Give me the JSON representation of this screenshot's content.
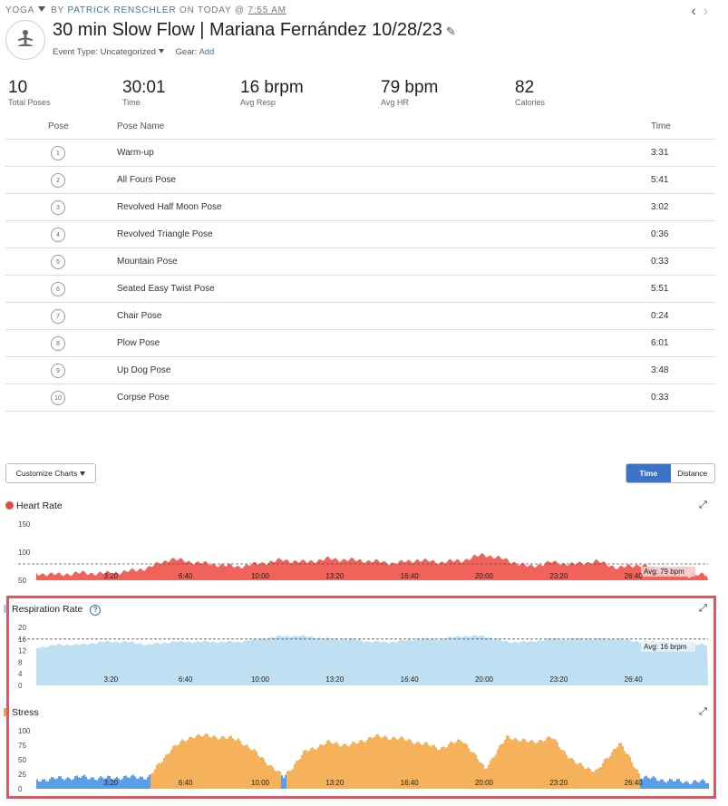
{
  "breadcrumb": {
    "activity_type": "YOGA",
    "by": "BY",
    "author": "PATRICK RENSCHLER",
    "on": "ON TODAY @",
    "time": "7:55 AM"
  },
  "pager": {
    "prev": "‹",
    "next": "›"
  },
  "activity": {
    "title": "30 min Slow Flow | Mariana Fernández 10/28/23",
    "event_type_label": "Event Type:",
    "event_type_value": "Uncategorized",
    "gear_label": "Gear:",
    "gear_link": "Add"
  },
  "stats": [
    {
      "value": "10",
      "label": "Total Poses"
    },
    {
      "value": "30:01",
      "label": "Time"
    },
    {
      "value": "16 brpm",
      "label": "Avg Resp"
    },
    {
      "value": "79 bpm",
      "label": "Avg HR"
    },
    {
      "value": "82",
      "label": "Calories"
    }
  ],
  "pose_table": {
    "headers": {
      "pose": "Pose",
      "name": "Pose Name",
      "time": "Time"
    },
    "rows": [
      {
        "num": "1",
        "name": "Warm-up",
        "time": "3:31"
      },
      {
        "num": "2",
        "name": "All Fours Pose",
        "time": "5:41"
      },
      {
        "num": "3",
        "name": "Revolved Half Moon Pose",
        "time": "3:02"
      },
      {
        "num": "4",
        "name": "Revolved Triangle Pose",
        "time": "0:36"
      },
      {
        "num": "5",
        "name": "Mountain Pose",
        "time": "0:33"
      },
      {
        "num": "6",
        "name": "Seated Easy Twist Pose",
        "time": "5:51"
      },
      {
        "num": "7",
        "name": "Chair Pose",
        "time": "0:24"
      },
      {
        "num": "8",
        "name": "Plow Pose",
        "time": "6:01"
      },
      {
        "num": "9",
        "name": "Up Dog Pose",
        "time": "3:48"
      },
      {
        "num": "10",
        "name": "Corpse Pose",
        "time": "0:33"
      }
    ]
  },
  "chart_controls": {
    "customize": "Customize Charts",
    "time_toggle": "Time",
    "distance_toggle": "Distance"
  },
  "colors": {
    "heart_rate": "#f0625a",
    "respiration": "#bfe0f3",
    "respiration_dot": "#a9c9e6",
    "stress_high": "#f5b25a",
    "stress_low": "#5b9ee8",
    "highlight_box": "#e25563",
    "toggle_active": "#3a73c8"
  },
  "x_ticks": [
    "3:20",
    "6:40",
    "10:00",
    "13:20",
    "16:40",
    "20:00",
    "23:20",
    "26:40"
  ],
  "chart_data": [
    {
      "type": "area",
      "title": "Heart Rate",
      "x": [
        0,
        60,
        120,
        180,
        240,
        300,
        360,
        420,
        480,
        540,
        600,
        660,
        720,
        780,
        840,
        900,
        960,
        1020,
        1080,
        1140,
        1200,
        1260,
        1320,
        1380,
        1440,
        1500,
        1560,
        1620,
        1680,
        1740,
        1800
      ],
      "values": [
        62,
        60,
        63,
        62,
        65,
        72,
        88,
        82,
        78,
        74,
        80,
        86,
        82,
        88,
        86,
        84,
        80,
        86,
        82,
        85,
        96,
        86,
        74,
        82,
        78,
        84,
        72,
        78,
        64,
        58,
        60
      ],
      "yticks": [
        50,
        100,
        150
      ],
      "ylim": [
        50,
        150
      ],
      "avg_label": "Avg: 79 bpm",
      "avg_value": 79
    },
    {
      "type": "area",
      "title": "Respiration Rate",
      "x": [
        0,
        60,
        120,
        180,
        240,
        300,
        360,
        420,
        480,
        540,
        600,
        660,
        720,
        780,
        840,
        900,
        960,
        1020,
        1080,
        1140,
        1200,
        1260,
        1320,
        1380,
        1440,
        1500,
        1560,
        1620,
        1680,
        1740,
        1800
      ],
      "values": [
        13,
        14,
        14,
        15,
        15,
        14,
        15,
        15,
        15,
        15,
        16,
        17,
        17,
        16,
        16,
        15,
        15,
        16,
        16,
        17,
        17,
        15,
        15,
        16,
        16,
        16,
        16,
        15,
        15,
        14,
        14
      ],
      "yticks": [
        0,
        4,
        8,
        12,
        16,
        20
      ],
      "ylim": [
        0,
        20
      ],
      "avg_label": "Avg: 16 brpm",
      "avg_value": 16
    },
    {
      "type": "area",
      "title": "Stress",
      "x": [
        0,
        60,
        120,
        180,
        240,
        300,
        360,
        420,
        480,
        540,
        600,
        660,
        720,
        780,
        840,
        900,
        960,
        1020,
        1080,
        1140,
        1200,
        1260,
        1320,
        1380,
        1440,
        1500,
        1560,
        1620,
        1680,
        1740,
        1800
      ],
      "values": [
        15,
        18,
        20,
        18,
        20,
        20,
        70,
        92,
        90,
        85,
        55,
        20,
        65,
        80,
        75,
        90,
        88,
        80,
        70,
        85,
        35,
        90,
        80,
        88,
        45,
        30,
        80,
        20,
        15,
        12,
        12
      ],
      "yticks": [
        0,
        25,
        50,
        75,
        100
      ],
      "ylim": [
        0,
        100
      ]
    }
  ]
}
